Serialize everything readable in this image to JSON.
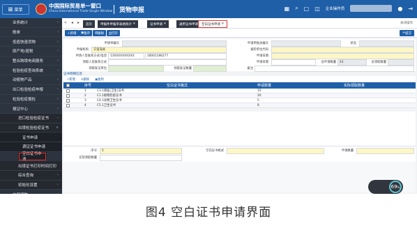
{
  "header": {
    "menu_label": "菜单",
    "logo_title": "中国国际贸易单一窗口",
    "logo_subtitle": "China International Trade Single Window",
    "app_title": "货物申报",
    "icons": [
      "calendar-icon",
      "search-icon",
      "lock-icon",
      "notice-icon",
      "user-icon",
      "logout-icon"
    ],
    "user_label": "企业操作员"
  },
  "sidebar": {
    "items": [
      {
        "label": "业务统计",
        "level": 0,
        "arrow": "‹"
      },
      {
        "label": "舱单",
        "level": 0,
        "arrow": "‹"
      },
      {
        "label": "低值快速货物",
        "level": 0,
        "arrow": "‹"
      },
      {
        "label": "原产地/退税",
        "level": 0,
        "arrow": "‹"
      },
      {
        "label": "整合跨境电商服务",
        "level": 0,
        "arrow": "‹"
      },
      {
        "label": "检验检疫查询系统",
        "level": 0,
        "arrow": "‹"
      },
      {
        "label": "动植物产品",
        "level": 0,
        "arrow": "‹"
      },
      {
        "label": "出口检验检疫申报",
        "level": 0,
        "arrow": "‹"
      },
      {
        "label": "检验检疫报检",
        "level": 0,
        "arrow": "‹"
      },
      {
        "label": "报证中心",
        "level": 0,
        "arrow": "‹"
      },
      {
        "label": "进口检验检疫证书",
        "level": 1,
        "arrow": "‹"
      },
      {
        "label": "出境检验检疫证书",
        "level": 1,
        "arrow": "∨"
      },
      {
        "label": "证书申请",
        "level": 2,
        "arrow": ""
      },
      {
        "label": "调证证书申请",
        "level": 2,
        "arrow": ""
      },
      {
        "label": "空白证书申请",
        "level": 2,
        "arrow": "",
        "selected": true
      },
      {
        "label": "出境证书打印时间打印",
        "level": 1,
        "arrow": ""
      },
      {
        "label": "综合查询",
        "level": 1,
        "arrow": "‹"
      },
      {
        "label": "初始化设置",
        "level": 1,
        "arrow": "‹"
      },
      {
        "label": "内贸货物",
        "level": 0,
        "arrow": "‹"
      }
    ]
  },
  "tabs": {
    "items": [
      "首页",
      "申报件申报单表格统计",
      "证书申请",
      "通用证书申请",
      "空白证书申请"
    ],
    "close": "✕",
    "options_label": "关闭操作"
  },
  "toolbar": {
    "buttons": [
      "新增",
      "暂存",
      "删除",
      "打印"
    ],
    "submit": "提交"
  },
  "form": {
    "apply_no_label": "申请单编号",
    "apply_no": "",
    "cert_no_label": "申请单报关编号",
    "cert_no": "",
    "status_label": "状态",
    "status": "",
    "org_label": "申报机构",
    "org": "宁波海关",
    "agency_label": "报检单位代码",
    "agency": "",
    "applicant_label": "申请人及联系方式/电话",
    "applicant": "130XXXXXXXXX",
    "phone": "18001186277",
    "date_label": "申请日期",
    "date": "",
    "contact_label": "领取人及联系方式",
    "contact": "",
    "issue_date_label": "申请日期",
    "issue_date": "",
    "total_label": "总申请数量",
    "total": "43",
    "approved_label": "总领取数量",
    "approved": "",
    "collect_label": "领取发证单位",
    "collect": "",
    "pickup_label": "领取发证数量",
    "pickup": "",
    "remark_label": "备注",
    "remark": ""
  },
  "section": {
    "title": "证书明细信息",
    "actions": [
      "新增",
      "删除",
      "复制"
    ]
  },
  "table": {
    "headers": [
      "序号",
      "空白证书格式",
      "申请数量",
      "实际领取数量"
    ],
    "rows": [
      {
        "no": "1",
        "format": "C3.1兽医(卫生)证书",
        "qty": "10",
        "actual": ""
      },
      {
        "no": "2",
        "format": "C1.1植物检疫证书",
        "qty": "20",
        "actual": ""
      },
      {
        "no": "3",
        "format": "C4.1动物卫生证书",
        "qty": "5",
        "actual": ""
      },
      {
        "no": "4",
        "format": "C5.1卫生证书",
        "qty": "8",
        "actual": ""
      }
    ]
  },
  "detail": {
    "seq_label": "序号",
    "seq": "5",
    "format_label": "空白证书格式",
    "format": "",
    "qty_label": "申请数量",
    "qty": "",
    "actual_label": "实际领取数量",
    "actual": ""
  },
  "badge": {
    "value": "69",
    "unit": "%"
  },
  "caption": "图4  空白证书申请界面"
}
